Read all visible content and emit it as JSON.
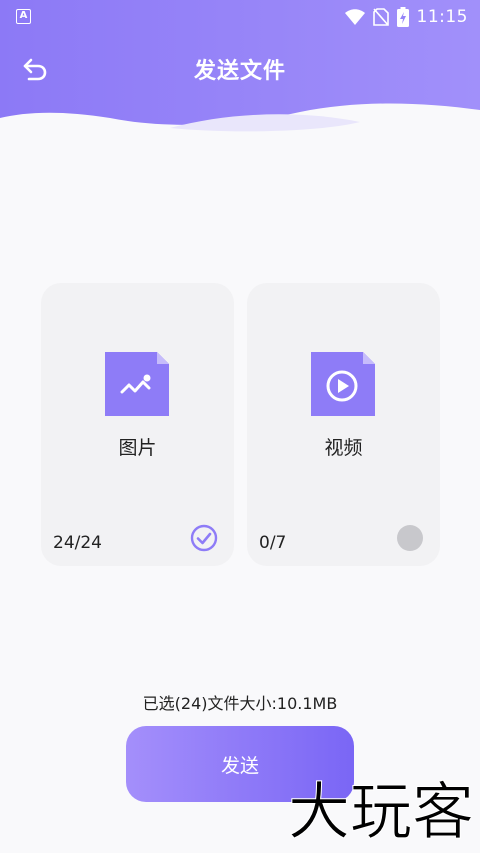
{
  "status_bar": {
    "time": "11:15",
    "left_badge": "A",
    "icons": [
      "wifi-icon",
      "no-sim-icon",
      "battery-charging-icon"
    ]
  },
  "header": {
    "title": "发送文件",
    "back_icon": "back-arrow-icon",
    "gradient_start": "#8e7cf7",
    "gradient_end": "#9f8ef9"
  },
  "cards": [
    {
      "label": "图片",
      "count": "24/24",
      "icon": "image-file-icon",
      "selected": true
    },
    {
      "label": "视频",
      "count": "0/7",
      "icon": "video-file-icon",
      "selected": false
    }
  ],
  "summary": "已选(24)文件大小:10.1MB",
  "send_button": {
    "label": "发送"
  },
  "watermark": "大玩客",
  "colors": {
    "accent": "#8e7cf7",
    "card_bg": "#f2f2f4",
    "page_bg": "#f9f9fb",
    "unchecked": "#c8c8cc"
  }
}
